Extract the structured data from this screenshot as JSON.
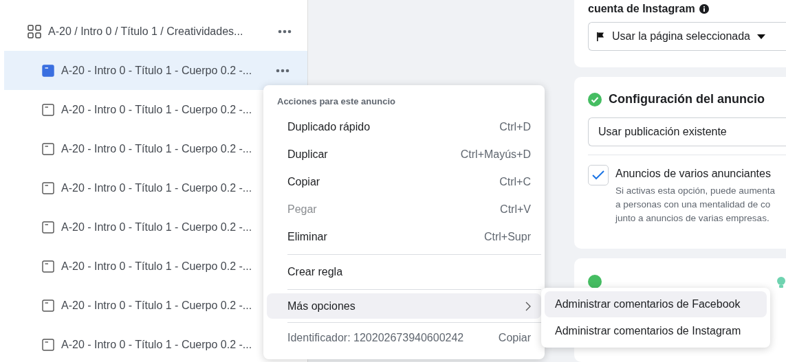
{
  "tree": {
    "parent": {
      "label": "A-20 / Intro 0 / Título 1 / Creatividades..."
    },
    "ads": [
      {
        "label": "A-20 - Intro 0 - Título 1 - Cuerpo 0.2 -...",
        "selected": true
      },
      {
        "label": "A-20 - Intro 0 - Título 1 - Cuerpo 0.2 -...",
        "selected": false
      },
      {
        "label": "A-20 - Intro 0 - Título 1 - Cuerpo 0.2 -...",
        "selected": false
      },
      {
        "label": "A-20 - Intro 0 - Título 1 - Cuerpo 0.2 -...",
        "selected": false
      },
      {
        "label": "A-20 - Intro 0 - Título 1 - Cuerpo 0.2 -...",
        "selected": false
      },
      {
        "label": "A-20 - Intro 0 - Título 1 - Cuerpo 0.2 -...",
        "selected": false
      },
      {
        "label": "A-20 - Intro 0 - Título 1 - Cuerpo 0.2 -...",
        "selected": false
      },
      {
        "label": "A-20 - Intro 0 - Título 1 - Cuerpo 0.2 -...",
        "selected": false
      }
    ]
  },
  "context_menu": {
    "title": "Acciones para este anuncio",
    "groups": [
      [
        {
          "label": "Duplicado rápido",
          "shortcut": "Ctrl+D",
          "disabled": false
        },
        {
          "label": "Duplicar",
          "shortcut": "Ctrl+Mayús+D",
          "disabled": false
        },
        {
          "label": "Copiar",
          "shortcut": "Ctrl+C",
          "disabled": false
        },
        {
          "label": "Pegar",
          "shortcut": "Ctrl+V",
          "disabled": true
        },
        {
          "label": "Eliminar",
          "shortcut": "Ctrl+Supr",
          "disabled": false
        }
      ],
      [
        {
          "label": "Crear regla",
          "disabled": false
        }
      ],
      [
        {
          "label": "Más opciones",
          "submenu": true,
          "selected": true,
          "disabled": false
        }
      ]
    ],
    "identifier": "Identificador: 120202673940600242",
    "copy_link": "Copiar"
  },
  "submenu": [
    {
      "label": "Administrar comentarios de Facebook",
      "selected": true
    },
    {
      "label": "Administrar comentarios de Instagram",
      "selected": false
    }
  ],
  "identity_card": {
    "title": "cuenta de Instagram",
    "dropdown": "Usar la página seleccionada"
  },
  "ad_setup_card": {
    "title": "Configuración del anuncio",
    "complete": true,
    "dropdown": "Usar publicación existente",
    "option": {
      "label": "Anuncios de varios anunciantes",
      "checked": true,
      "description": [
        "Si activas esta opción, puede aumenta",
        "a personas con una mentalidad de co",
        "junto a anuncios de varias empresas."
      ]
    }
  },
  "content_card": {
    "complete": true
  }
}
